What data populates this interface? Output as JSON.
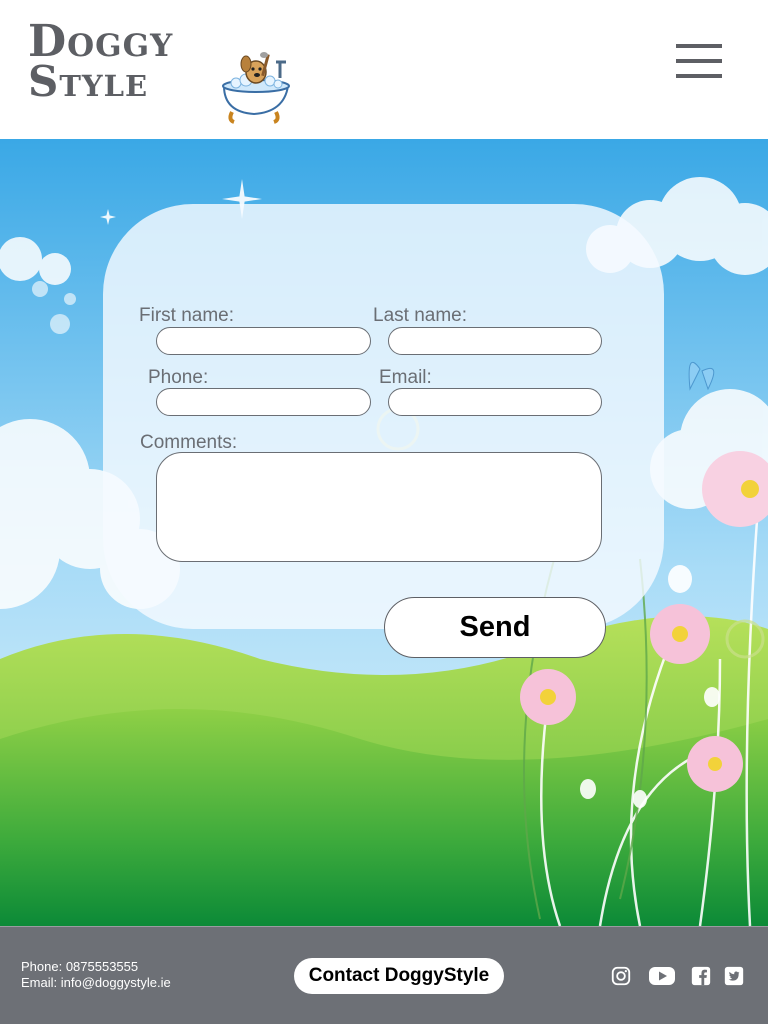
{
  "header": {
    "logo_line1": "Doggy",
    "logo_line2": "Style",
    "menu_icon": "hamburger-menu-icon"
  },
  "form": {
    "first_name_label": "First name:",
    "last_name_label": "Last name:",
    "phone_label": "Phone:",
    "email_label": "Email:",
    "comments_label": "Comments:",
    "first_name_value": "",
    "last_name_value": "",
    "phone_value": "",
    "email_value": "",
    "comments_value": "",
    "send_label": "Send"
  },
  "footer": {
    "phone_text": "Phone: 0875553555",
    "email_text": "Email: info@doggystyle.ie",
    "contact_button": "Contact DoggyStyle",
    "social_icons": [
      "instagram-icon",
      "youtube-icon",
      "facebook-icon",
      "twitter-icon"
    ]
  },
  "colors": {
    "logo_gray": "#5d5f64",
    "footer_bg": "#6d7076",
    "sky_blue": "#4db3ea",
    "grass_green": "#4cae35"
  }
}
